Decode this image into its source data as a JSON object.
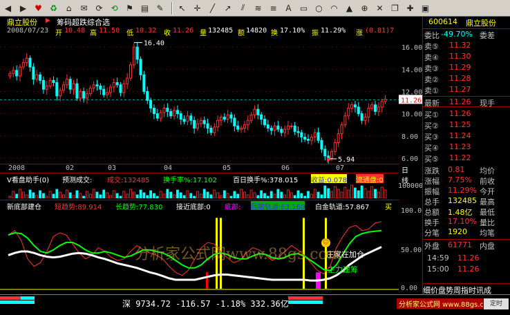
{
  "toolbar": {
    "icons": [
      "back-arrow-icon",
      "forward-arrow-icon",
      "heart-icon",
      "recycle-icon",
      "home-icon",
      "mail-icon",
      "cursor-icon",
      "crosshair-icon",
      "line-tool-icon",
      "ray-tool-icon",
      "parallel-tool-icon",
      "text-tool-icon",
      "rectangle-icon",
      "circle-icon",
      "arc-icon",
      "up-arrow-icon",
      "delete-icon",
      "copy-icon",
      "pin-icon",
      "save-icon"
    ]
  },
  "header": {
    "stock_name": "鼎立股份",
    "formula_name": "筹码超跌综合选"
  },
  "stats": {
    "date": "2008/07/23",
    "open_label": "开",
    "open": "10.48",
    "high_label": "高",
    "high": "11.50",
    "low_label": "低",
    "low": "10.32",
    "close_label": "收",
    "close": "11.26",
    "volume_label": "量",
    "volume": "132485",
    "amount_label": "额",
    "amount": "14820",
    "turnover_label": "换",
    "turnover": "17.10%",
    "amplitude_label": "振",
    "amplitude": "11.29%",
    "change_label": "涨",
    "change": "(0.81)7"
  },
  "kline": {
    "annot_high": "16.40",
    "annot_low": "5.94",
    "last_price_tag": "11.26",
    "y_labels": [
      "16.00",
      "14.00",
      "12.00",
      "10.00",
      "8.00",
      "6.00"
    ],
    "date_labels": [
      "2008",
      "02",
      "03",
      "04",
      "05",
      "06",
      "07"
    ],
    "period": "日线"
  },
  "volume_panel": {
    "title": "V看盘助手(0)",
    "predict_label": "预测成交:",
    "chengjiao": "成交:132485",
    "huanshou": "换手率%:17.102",
    "baihuanshou": "百日换手%:378.015",
    "shouyi": "收益:0.078",
    "liutong": "流通盘:0",
    "y_label": "100000"
  },
  "indicator_panel": {
    "title": "新底部建仓",
    "short_trend": "短趋势:89.914",
    "long_trend": "长趋势:77.830",
    "near_bottom": "接近底部:0",
    "bottom": "底部:",
    "lower_rail": "回撤轨道:63.160",
    "gold_rail": "白金轨道:57.867",
    "buy": "买",
    "y_labels": [
      "100.00",
      "50.00",
      "0.00"
    ],
    "annot_1": "庄家在加仓",
    "annot_2": "主力建筹"
  },
  "watermark": "分析家公式网www.88gs.com",
  "quote": {
    "code": "600614",
    "name": "鼎立股份",
    "weibi_label": "委比",
    "weibi": "-49.70%",
    "weicha_label": "委差",
    "asks": [
      {
        "label": "卖⑤",
        "price": "11.32"
      },
      {
        "label": "卖④",
        "price": "11.30"
      },
      {
        "label": "卖③",
        "price": "11.29"
      },
      {
        "label": "卖②",
        "price": "11.28"
      },
      {
        "label": "卖①",
        "price": "11.27"
      }
    ],
    "last_label": "最新",
    "last": "11.26",
    "spot_label": "现手",
    "bids": [
      {
        "label": "买①",
        "price": "11.26"
      },
      {
        "label": "买②",
        "price": "11.25"
      },
      {
        "label": "买③",
        "price": "11.24"
      },
      {
        "label": "买④",
        "price": "11.23"
      },
      {
        "label": "买⑤",
        "price": "11.22"
      }
    ],
    "rows": [
      {
        "l": "涨跌",
        "v": "0.81",
        "r": "均价"
      },
      {
        "l": "涨幅",
        "v": "7.75%",
        "r": "前收"
      },
      {
        "l": "振幅",
        "v": "11.29%",
        "r": "今开"
      },
      {
        "l": "总手",
        "v": "132485",
        "r": "最高"
      },
      {
        "l": "总额",
        "v": "1.48亿",
        "r": "最低"
      },
      {
        "l": "换手",
        "v": "17.10%",
        "r": "量比"
      },
      {
        "l": "分笔",
        "v": "1920",
        "r": "均笔"
      }
    ],
    "outer_label": "外盘",
    "outer": "61771",
    "inner_label": "内盘",
    "ticks": [
      {
        "time": "14:59",
        "price": "11.26"
      },
      {
        "time": "15:00",
        "price": "11.26"
      }
    ],
    "footer_tabs": "细价盘势周指时讯成"
  },
  "bottom": {
    "index": "深 9734.72 -116.57 -1.18% 332.36亿",
    "brand": "分析家公式网 www.88gs.com",
    "clock": "定时"
  },
  "colors": {
    "up": "#ff3232",
    "down": "#00ffff",
    "yellow": "#ffff00",
    "magenta": "#ff00ff",
    "green": "#00ff00",
    "grid": "#a00000"
  },
  "chart_data": [
    {
      "type": "candlestick",
      "title": "鼎立股份",
      "x_labels": [
        "2008",
        "02",
        "03",
        "04",
        "05",
        "06",
        "07"
      ],
      "ylim": [
        5.5,
        17
      ],
      "y_ticks": [
        6,
        8,
        10,
        12,
        14,
        16
      ],
      "annotations": [
        {
          "label": "16.40",
          "y": 16.4
        },
        {
          "label": "5.94",
          "y": 5.94
        }
      ],
      "last_price": 11.26,
      "close": [
        13.6,
        13.9,
        13.4,
        14.2,
        14.6,
        15.0,
        14.2,
        13.1,
        13.5,
        13.0,
        12.2,
        12.5,
        13.0,
        12.8,
        11.6,
        12.1,
        12.6,
        13.1,
        12.2,
        12.7,
        11.4,
        12.0,
        11.4,
        11.8,
        12.3,
        12.6,
        12.5,
        12.2,
        11.7,
        11.9,
        12.4,
        12.8,
        12.6,
        11.9,
        12.7,
        13.2,
        14.4,
        16.0,
        14.9,
        13.5,
        12.0,
        11.2,
        10.5,
        10.0,
        9.6,
        10.1,
        10.5,
        10.2,
        9.8,
        10.3,
        10.0,
        9.5,
        9.3,
        9.8,
        9.4,
        8.7,
        9.1,
        9.4,
        9.1,
        8.7,
        8.3,
        8.8,
        9.4,
        9.7,
        9.5,
        9.9,
        9.6,
        8.9,
        8.6,
        8.7,
        9.0,
        9.4,
        9.9,
        10.4,
        9.9,
        9.5,
        9.0,
        8.7,
        8.5,
        8.9,
        8.6,
        8.3,
        8.6,
        8.9,
        8.9,
        8.4,
        8.3,
        7.9,
        7.7,
        7.6,
        7.9,
        8.3,
        7.6,
        6.8,
        6.2,
        6.0,
        6.6,
        7.4,
        8.2,
        9.0,
        9.8,
        10.5,
        10.8,
        10.6,
        10.0,
        9.4,
        9.7,
        10.5,
        10.8,
        10.2,
        10.6,
        11.1,
        11.3
      ]
    },
    {
      "type": "line",
      "title": "新底部建仓",
      "ylim": [
        0,
        100
      ],
      "y_ticks": [
        0,
        50,
        100
      ],
      "series": [
        {
          "name": "短趋势",
          "color": "#ff3232",
          "values": [
            72,
            78,
            65,
            40,
            30,
            35,
            50,
            70,
            75,
            72,
            60,
            48,
            40,
            45,
            55,
            50,
            42,
            38,
            40,
            50,
            58,
            52,
            48,
            45,
            40,
            30,
            22,
            18,
            25,
            40,
            55,
            62,
            60,
            50,
            42,
            35,
            38,
            48,
            55,
            52,
            45,
            38,
            42,
            50,
            58,
            52,
            45,
            35,
            25,
            20,
            30,
            55,
            70,
            82,
            85,
            78,
            80,
            88,
            90
          ]
        },
        {
          "name": "长趋势",
          "color": "#00ff00",
          "values": [
            72,
            75,
            74,
            68,
            58,
            50,
            48,
            52,
            58,
            62,
            62,
            58,
            52,
            48,
            48,
            50,
            48,
            45,
            42,
            44,
            48,
            52,
            52,
            50,
            48,
            44,
            38,
            32,
            28,
            28,
            32,
            40,
            46,
            48,
            46,
            42,
            40,
            40,
            44,
            47,
            46,
            42,
            40,
            42,
            46,
            47,
            44,
            38,
            32,
            26,
            24,
            32,
            46,
            60,
            70,
            74,
            76,
            77,
            78
          ]
        },
        {
          "name": "白金轨道",
          "color": "#ffffff",
          "values": [
            45,
            48,
            50,
            50,
            48,
            45,
            43,
            42,
            43,
            45,
            47,
            48,
            47,
            45,
            42,
            40,
            37,
            34,
            32,
            30,
            28,
            25,
            22,
            20,
            17,
            14,
            12,
            12,
            12,
            12,
            14,
            16,
            18,
            19,
            19,
            18,
            17,
            16,
            15,
            14,
            13,
            12,
            12,
            12,
            12,
            12,
            12,
            11,
            11,
            12,
            14,
            18,
            24,
            32,
            38,
            44,
            48,
            52,
            56
          ]
        }
      ]
    }
  ]
}
